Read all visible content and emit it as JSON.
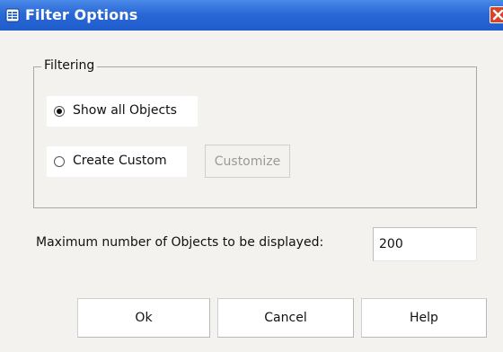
{
  "window": {
    "title": "Filter Options",
    "icon": "dialog-icon",
    "close_icon": "close-icon"
  },
  "filtering": {
    "group_label": "Filtering",
    "options": [
      {
        "label": "Show all Objects",
        "selected": true
      },
      {
        "label": "Create Custom",
        "selected": false
      }
    ],
    "customize_label": "Customize"
  },
  "max_objects": {
    "label": "Maximum number of Objects to be displayed:",
    "value": "200"
  },
  "buttons": {
    "ok": "Ok",
    "cancel": "Cancel",
    "help": "Help"
  },
  "colors": {
    "titlebar": "#2a68d6",
    "background": "#f3f2ee"
  }
}
